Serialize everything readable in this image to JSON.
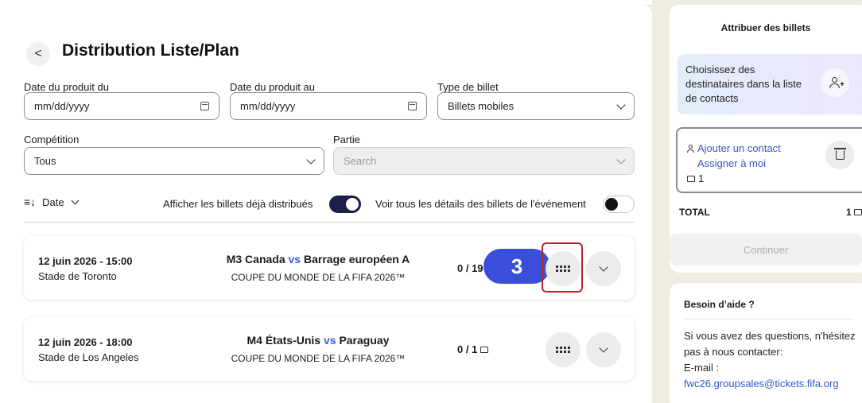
{
  "page": {
    "back_label": "<",
    "title": "Distribution Liste/Plan"
  },
  "filters": {
    "date_from": {
      "label": "Date du produit du",
      "value": "mm/dd/yyyy"
    },
    "date_to": {
      "label": "Date du produit au",
      "value": "mm/dd/yyyy"
    },
    "ticket_type": {
      "label": "Type de billet",
      "value": "Billets mobiles"
    },
    "competition": {
      "label": "Compétition",
      "value": "Tous"
    },
    "match": {
      "label": "Partie",
      "placeholder": "Search"
    }
  },
  "sort": {
    "icon": "sort-icon",
    "label": "Date"
  },
  "toggles": {
    "show_distributed": {
      "label": "Afficher les billets déjà distribués",
      "state": "on"
    },
    "show_details": {
      "label": "Voir tous les détails des billets de l'événement",
      "state": "off"
    }
  },
  "events": [
    {
      "date": "12 juin 2026 - 15:00",
      "venue": "Stade de Toronto",
      "match_code": "M3",
      "home": "Canada",
      "vs": "vs",
      "away": "Barrage européen A",
      "competition": "COUPE DU MONDE DE LA FIFA 2026™",
      "count": "0 / 19"
    },
    {
      "date": "12 juin 2026 - 18:00",
      "venue": "Stade de Los Angeles",
      "match_code": "M4",
      "home": "États-Unis",
      "vs": "vs",
      "away": "Paraguay",
      "competition": "COUPE DU MONDE DE LA FIFA 2026™",
      "count": "0 / 1"
    }
  ],
  "step_badge": "3",
  "sidebar": {
    "title": "Attribuer des billets",
    "choose_text": "Choisissez des destinataires dans la liste de contacts",
    "add_contact": "Ajouter un contact",
    "assign_me": "Assigner à moi",
    "ticket_count": "1",
    "total_label": "TOTAL",
    "total_value": "1",
    "continue_label": "Continuer"
  },
  "help": {
    "title": "Besoin d’aide ?",
    "text": "Si vous avez des questions, n'hésitez pas à nous contacter:",
    "email_label": "E-mail :",
    "email": "fwc26.groupsales@tickets.fifa.org"
  },
  "colors": {
    "accent": "#3a4fd9",
    "toggle_on": "#1b1f4a",
    "highlight": "#b3262c",
    "link": "#3256c8"
  }
}
